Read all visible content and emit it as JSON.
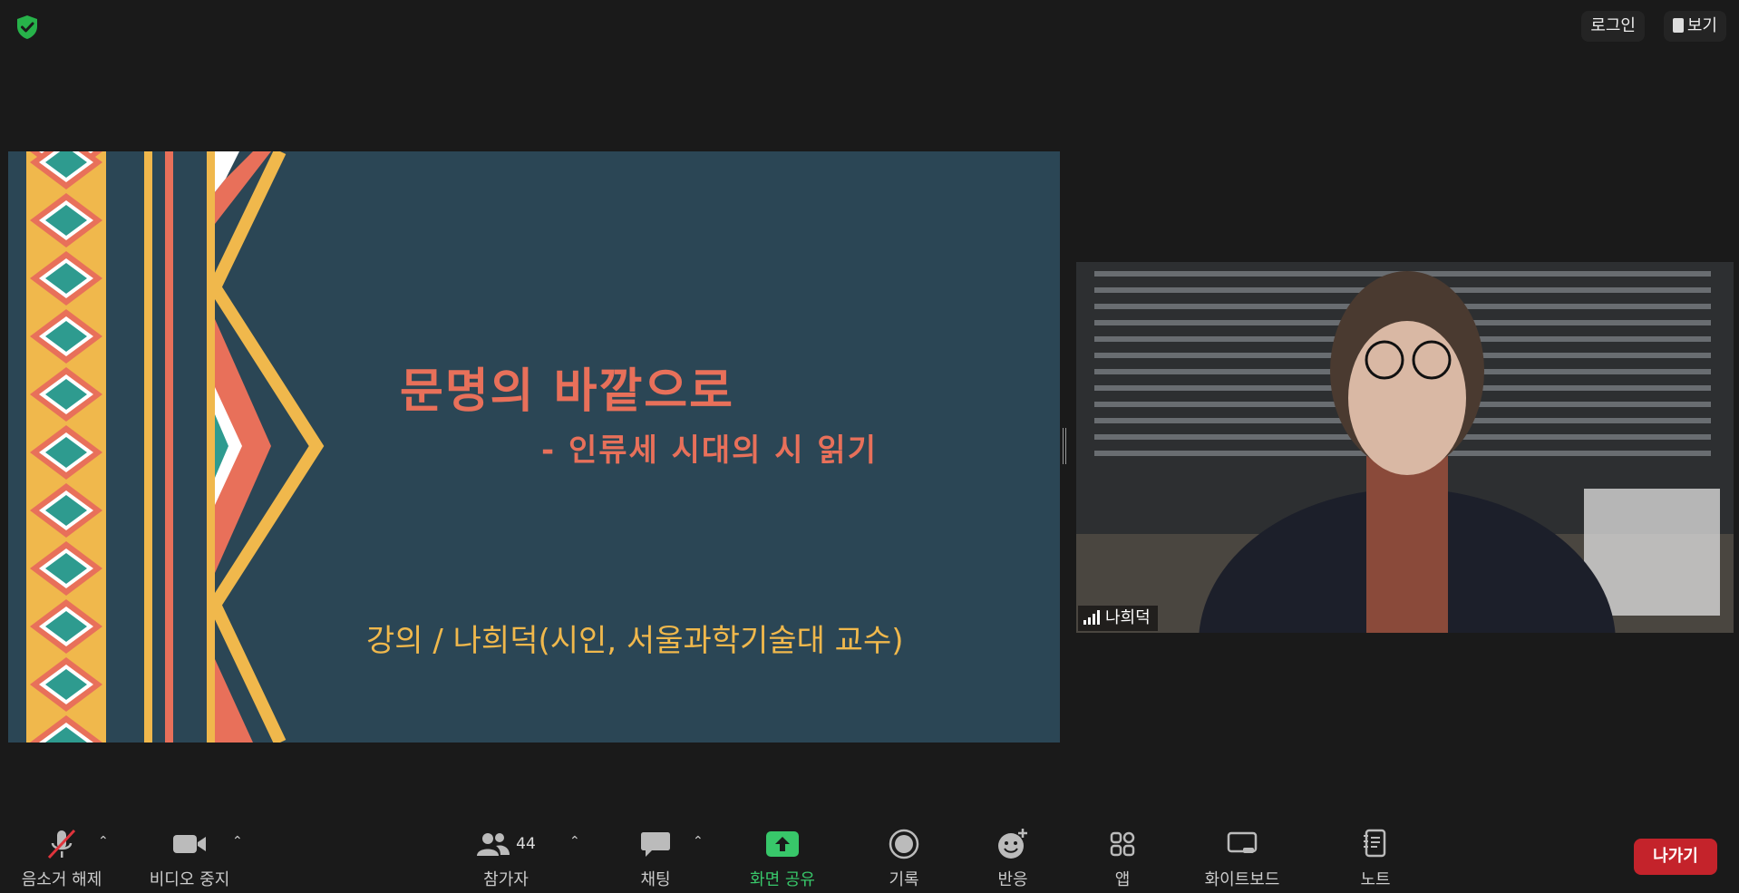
{
  "header": {
    "login_label": "로그인",
    "view_label": "보기"
  },
  "slide": {
    "title": "문명의 바깥으로",
    "subtitle": "- 인류세 시대의 시 읽기",
    "lecturer": "강의 / 나희덕(시인, 서울과학기술대 교수)"
  },
  "participant": {
    "name": "나희덕"
  },
  "toolbar": {
    "unmute_label": "음소거 해제",
    "stop_video_label": "비디오 중지",
    "participants_label": "참가자",
    "participants_count": "44",
    "chat_label": "채팅",
    "share_label": "화면 공유",
    "record_label": "기록",
    "reactions_label": "반응",
    "apps_label": "앱",
    "whiteboard_label": "화이트보드",
    "notes_label": "노트",
    "leave_label": "나가기"
  },
  "colors": {
    "background": "#1a1a1a",
    "slide_bg": "#2b4655",
    "slide_title": "#e8705a",
    "slide_lecturer": "#f0b84c",
    "share_green": "#38c76a",
    "leave_red": "#c4232b",
    "security_green": "#27b24a"
  }
}
